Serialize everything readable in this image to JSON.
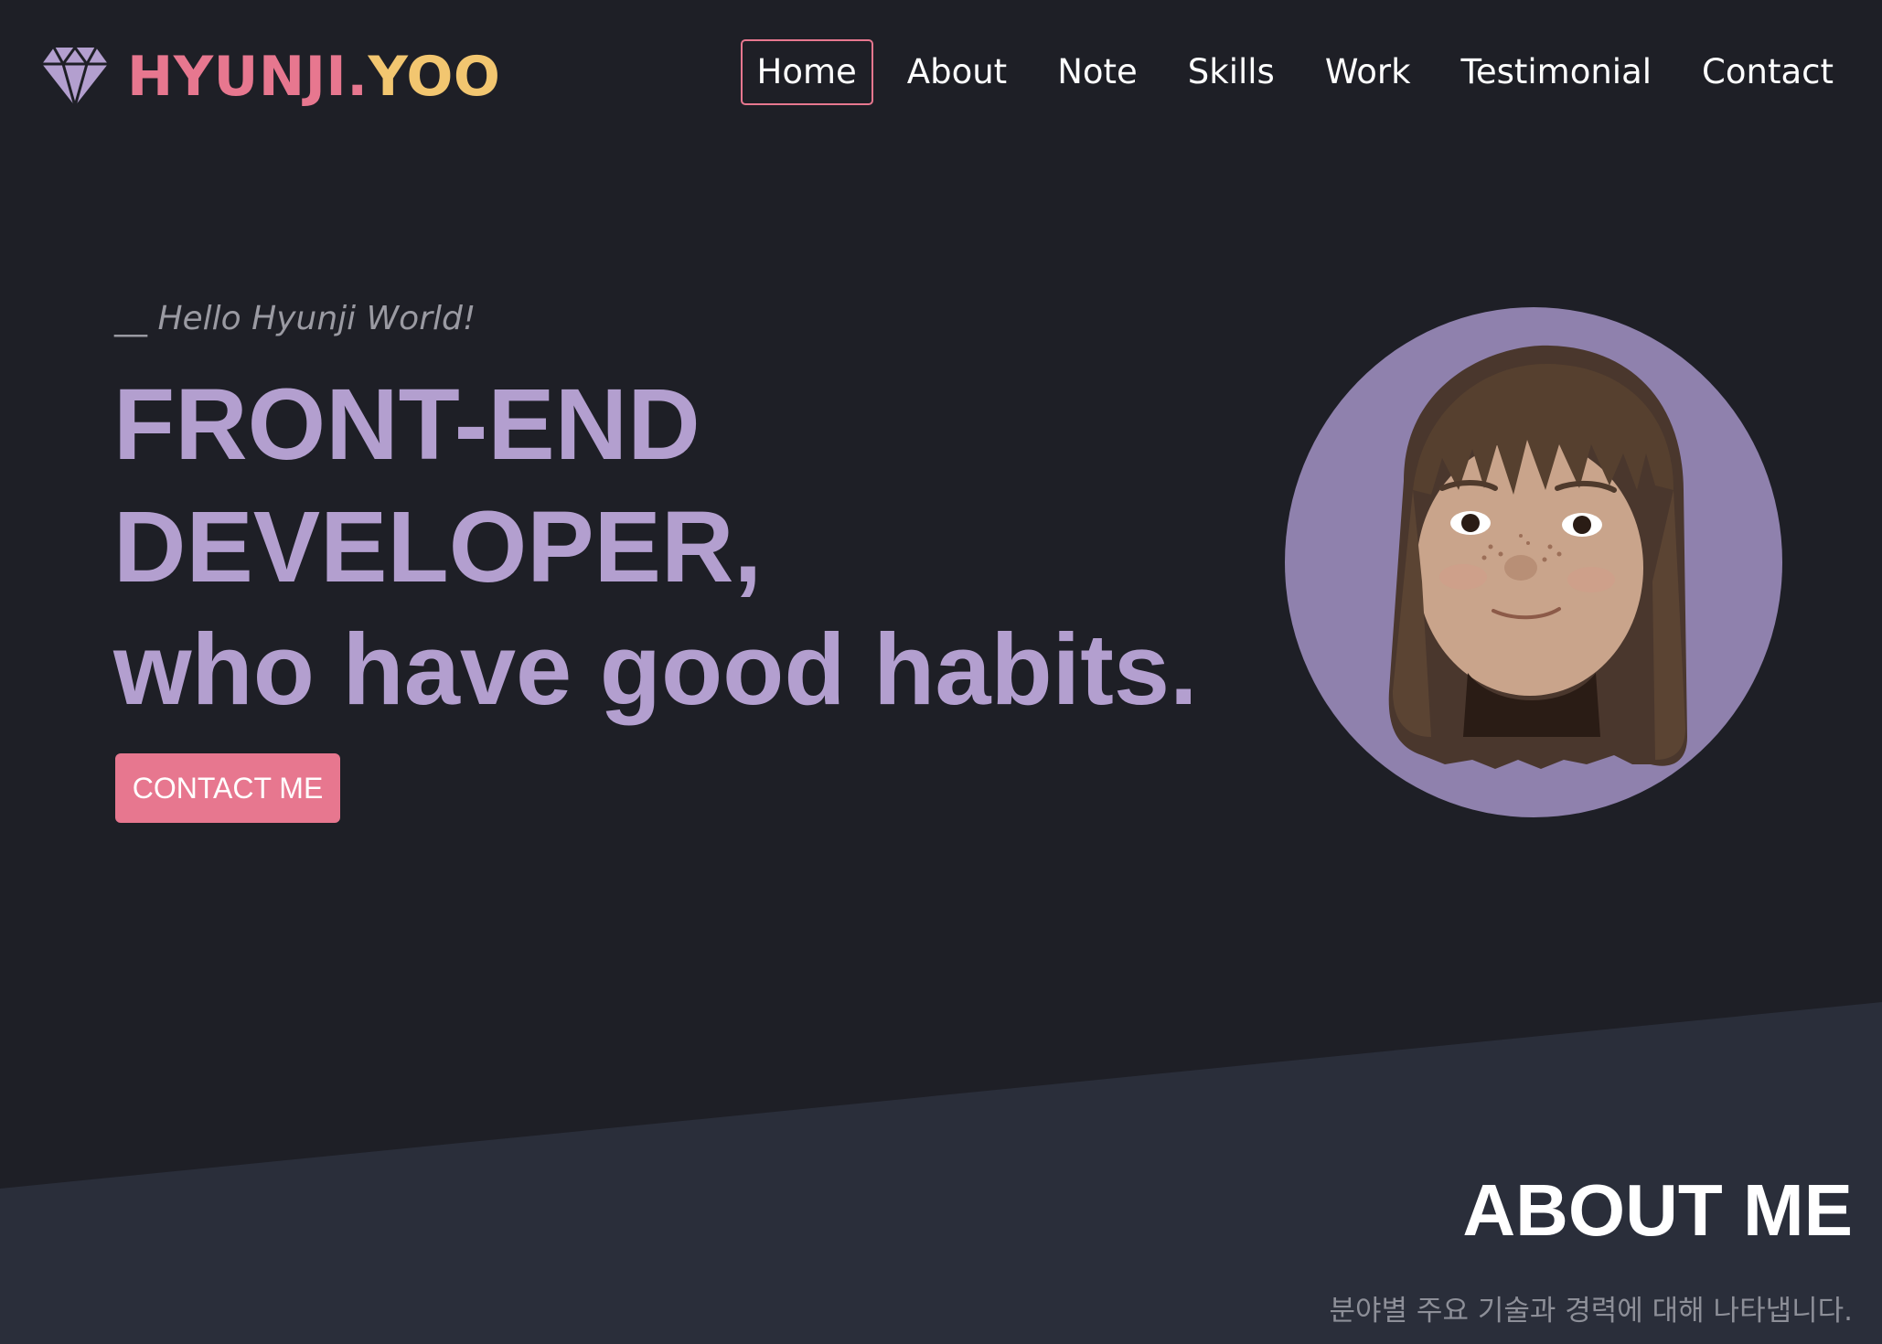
{
  "brand": {
    "name_part1": "HYUNJI.",
    "name_part2": "YOO",
    "icon": "diamond-icon",
    "colors": {
      "pink": "#e7778f",
      "yellow": "#f2c670",
      "purple": "#b39fcf"
    }
  },
  "nav": {
    "items": [
      {
        "label": "Home",
        "active": true
      },
      {
        "label": "About",
        "active": false
      },
      {
        "label": "Note",
        "active": false
      },
      {
        "label": "Skills",
        "active": false
      },
      {
        "label": "Work",
        "active": false
      },
      {
        "label": "Testimonial",
        "active": false
      },
      {
        "label": "Contact",
        "active": false
      }
    ]
  },
  "hero": {
    "greeting": "__ Hello Hyunji World!",
    "title_lines": [
      "FRONT-END",
      "DEVELOPER,",
      "who have good habits."
    ],
    "button_label": "CONTACT ME",
    "avatar": "avatar-memoji"
  },
  "about": {
    "title": "ABOUT ME",
    "description": "분야별 주요 기술과 경력에 대해 나타냅니다."
  },
  "theme": {
    "background": "#1e1f26",
    "section_background": "#2a2e3a",
    "avatar_background": "#8f81ad"
  }
}
